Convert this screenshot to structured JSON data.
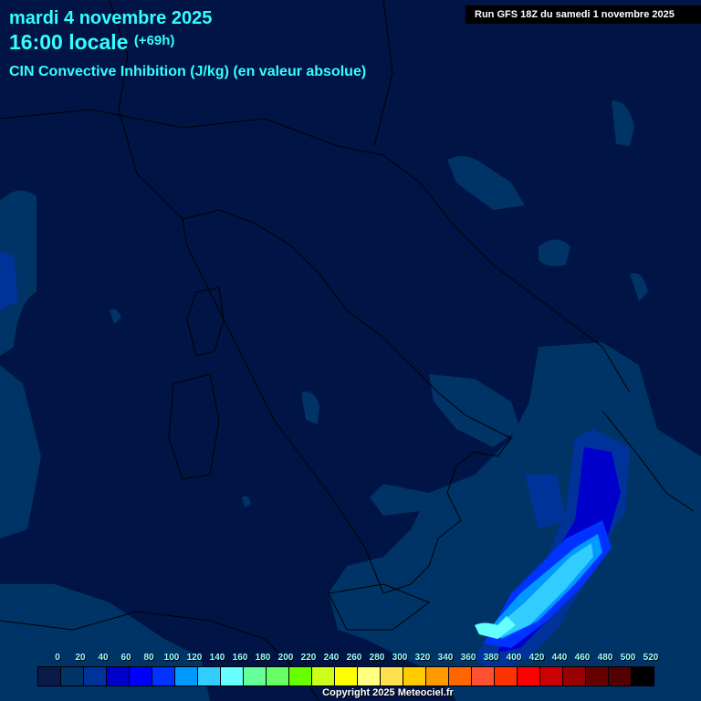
{
  "header": {
    "date": "mardi 4 novembre 2025",
    "time": "16:00 locale",
    "offset": "(+69h)",
    "parameter": "CIN Convective Inhibition (J/kg) (en valeur absolue)",
    "run": "Run GFS 18Z du samedi 1 novembre 2025"
  },
  "legend": {
    "labels": [
      "0",
      "20",
      "40",
      "60",
      "80",
      "100",
      "120",
      "140",
      "160",
      "180",
      "200",
      "220",
      "240",
      "260",
      "280",
      "300",
      "320",
      "340",
      "360",
      "380",
      "400",
      "420",
      "440",
      "460",
      "480",
      "500",
      "520"
    ],
    "colors": [
      "#0a1a4a",
      "#003366",
      "#003399",
      "#0000cc",
      "#0000ff",
      "#0033ff",
      "#0099ff",
      "#33ccff",
      "#66ffff",
      "#66ff99",
      "#66ff66",
      "#66ff00",
      "#ccff1a",
      "#ffff00",
      "#ffff80",
      "#ffe050",
      "#ffcc00",
      "#ff9900",
      "#ff6600",
      "#ff5033",
      "#ff3300",
      "#ff0000",
      "#cc0000",
      "#990000",
      "#660000",
      "#550000",
      "#000000"
    ]
  },
  "footer": {
    "copyright": "Copyright 2025 Meteociel.fr"
  }
}
